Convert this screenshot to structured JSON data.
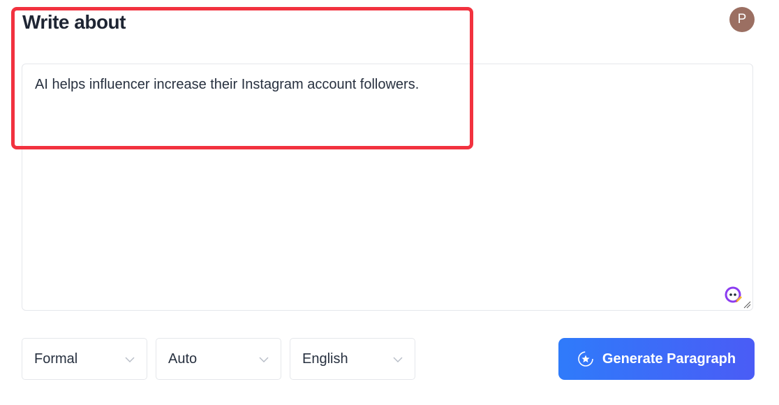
{
  "header": {
    "title": "Write about",
    "avatar_initial": "P"
  },
  "editor": {
    "value": "AI helps influencer increase their Instagram account followers."
  },
  "controls": {
    "tone": "Formal",
    "length": "Auto",
    "language": "English"
  },
  "actions": {
    "generate_label": "Generate Paragraph"
  },
  "colors": {
    "highlight": "#f2323f",
    "accent": "#3b6cf8",
    "avatar": "#9b6f62"
  }
}
